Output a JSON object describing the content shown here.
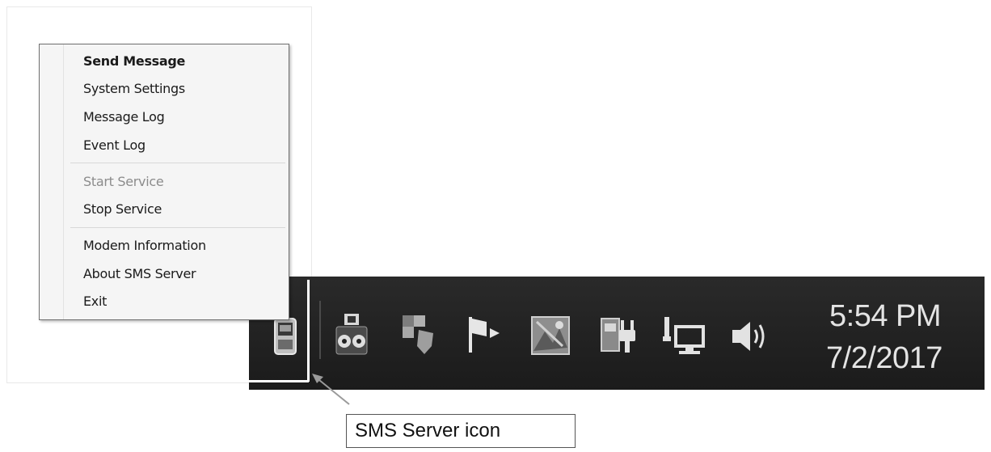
{
  "context_menu": {
    "items": [
      {
        "label": "Send Message",
        "bold": true,
        "enabled": true
      },
      {
        "label": "System Settings",
        "enabled": true
      },
      {
        "label": "Message Log",
        "enabled": true
      },
      {
        "label": "Event Log",
        "enabled": true
      },
      {
        "label": "Start Service",
        "enabled": false
      },
      {
        "label": "Stop Service",
        "enabled": true
      },
      {
        "label": "Modem Information",
        "enabled": true
      },
      {
        "label": "About SMS Server",
        "enabled": true
      },
      {
        "label": "Exit",
        "enabled": true
      }
    ]
  },
  "taskbar": {
    "tray_icons": [
      "sms-server-icon",
      "camera-app-icon",
      "shield-app-icon",
      "action-center-flag-icon",
      "image-app-icon",
      "power-plug-icon",
      "network-icon",
      "volume-icon"
    ],
    "clock": {
      "time": "5:54 PM",
      "date": "7/2/2017"
    }
  },
  "callout": {
    "label": "SMS Server icon"
  }
}
